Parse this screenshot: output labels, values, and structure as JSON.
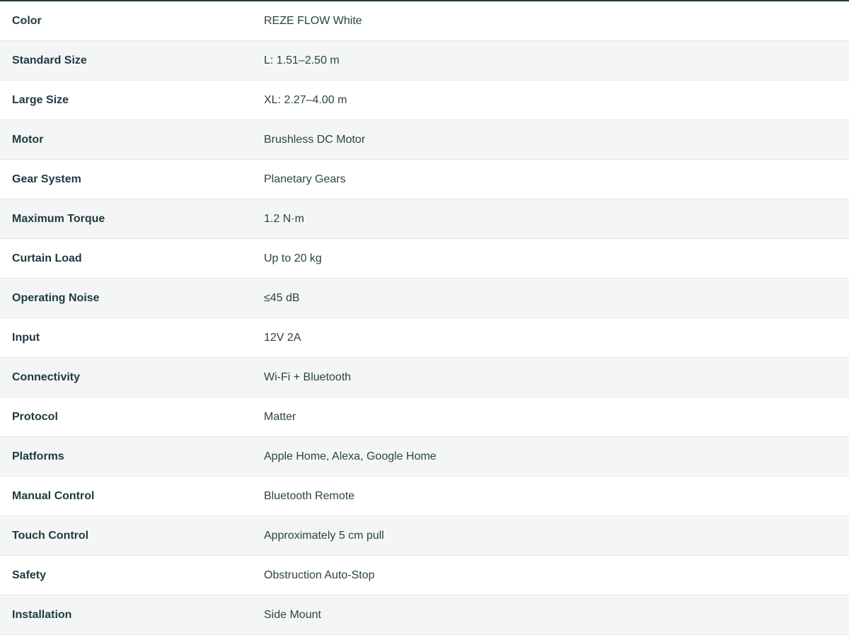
{
  "specs": [
    {
      "label": "Color",
      "value": "REZE FLOW White"
    },
    {
      "label": "Standard Size",
      "value": "L: 1.51–2.50 m"
    },
    {
      "label": "Large Size",
      "value": "XL: 2.27–4.00 m"
    },
    {
      "label": "Motor",
      "value": "Brushless DC Motor"
    },
    {
      "label": "Gear System",
      "value": "Planetary Gears"
    },
    {
      "label": "Maximum Torque",
      "value": "1.2 N·m"
    },
    {
      "label": "Curtain Load",
      "value": "Up to 20 kg"
    },
    {
      "label": "Operating Noise",
      "value": "≤45 dB"
    },
    {
      "label": "Input",
      "value": "12V 2A"
    },
    {
      "label": "Connectivity",
      "value": "Wi-Fi + Bluetooth"
    },
    {
      "label": "Protocol",
      "value": "Matter"
    },
    {
      "label": "Platforms",
      "value": "Apple Home, Alexa, Google Home"
    },
    {
      "label": "Manual Control",
      "value": "Bluetooth Remote"
    },
    {
      "label": "Touch Control",
      "value": "Approximately 5 cm pull"
    },
    {
      "label": "Safety",
      "value": "Obstruction Auto-Stop"
    },
    {
      "label": "Installation",
      "value": "Side Mount"
    }
  ]
}
